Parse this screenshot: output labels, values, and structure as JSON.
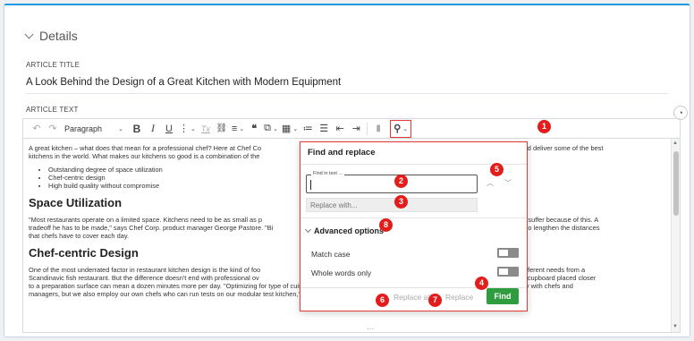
{
  "details": {
    "title": "Details"
  },
  "article_title": {
    "label": "ARTICLE TITLE",
    "value": "A Look Behind the Design of a Great Kitchen with Modern Equipment"
  },
  "article_text": {
    "label": "ARTICLE TEXT"
  },
  "toolbar": {
    "paragraph": "Paragraph",
    "bold": "B",
    "italic": "I",
    "underline": "U",
    "more": "⋮",
    "clear_format": "Tx",
    "link": "⛓",
    "align": "≡",
    "quote": "❝",
    "table": "▦",
    "numbered_list": "≔",
    "bullet_list": "☰",
    "indent_less": "⇤",
    "indent_more": "⇥",
    "paste": "📋",
    "find": "🔍"
  },
  "editor": {
    "intro": "A great kitchen – what does that mean for a professional chef? Here at Chef Co",
    "intro_cont": "sign, build, and deliver some of the best",
    "intro2": "kitchens in the world. What makes our kitchens so good is a combination of the",
    "bullets": [
      "Outstanding degree of space utilization",
      "Chef-centric design",
      "High build quality without compromise"
    ],
    "h1": "Space Utilization",
    "p1a": "\"Most restaurants operate on a limited space. Kitchens need to be as small as p",
    "p1a_cont": "ood quality can't suffer because of this. A",
    "p1b": "tradeoff he has to be made,\" says Chef Corp. product manager George Pastore. \"Bi",
    "p1b_cont": "ge kitchens also lengthen the distances",
    "p1c": "that chefs have to cover each day.",
    "h2": "Chef-centric Design",
    "p2a": "One of the most underrated factor in restaurant kitchen design is the kind of foo",
    "p2a_cont": "aurant has different needs from a",
    "p2b": "Scandinavic fish restaurant. But the difference doesn't end with professional ov",
    "p2b_cont": "can be achieved. A cupboard placed closer",
    "p2c": "to a preparation surface can mean a dozen minutes more per day. \"Optimizing for type of cuisine, or even single recipes takes a lot of experience. Chef Corp. works closely with chefs and",
    "p2d": "managers, but we also employ our own chefs who can run tests on our modular test kitchen,\" says George."
  },
  "find_replace": {
    "title": "Find and replace",
    "find_legend": "Find in text ...",
    "find_value": "",
    "replace_placeholder": "Replace with...",
    "advanced": "Advanced options",
    "match_case": "Match case",
    "whole_words": "Whole words only",
    "replace_all": "Replace all",
    "replace": "Replace",
    "find": "Find"
  },
  "badges": [
    "1",
    "2",
    "3",
    "4",
    "5",
    "6",
    "7",
    "8"
  ],
  "colors": {
    "accent": "#1e9be0",
    "badge": "#e31c1c",
    "find_button": "#2e9c3f"
  }
}
